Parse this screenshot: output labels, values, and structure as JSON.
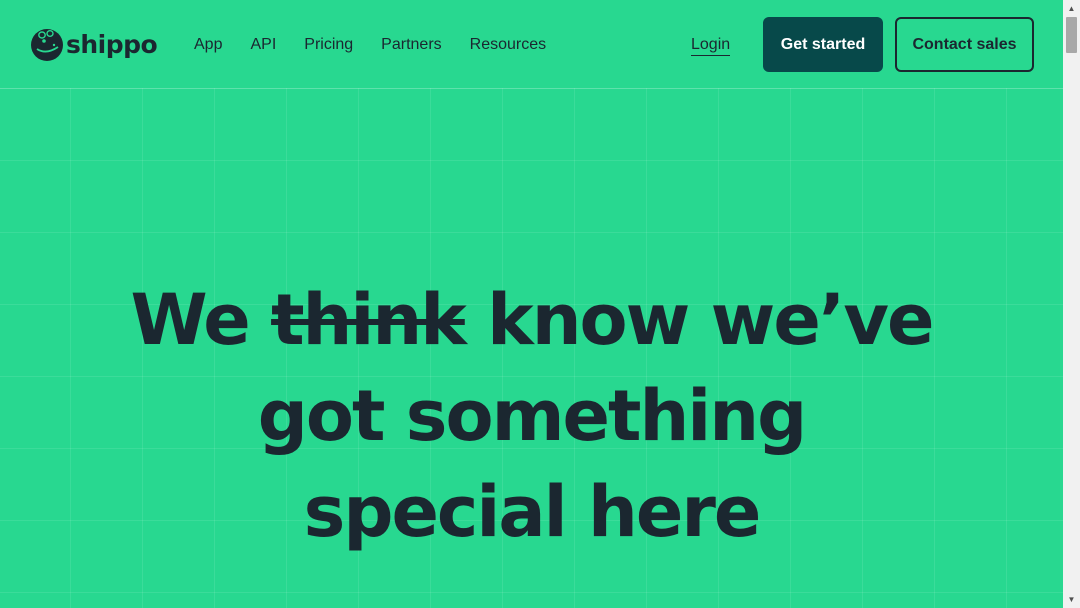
{
  "brand": {
    "name": "shippo",
    "logo_icon": "hippo-logo-icon"
  },
  "nav": {
    "items": [
      {
        "label": "App"
      },
      {
        "label": "API"
      },
      {
        "label": "Pricing"
      },
      {
        "label": "Partners"
      },
      {
        "label": "Resources"
      }
    ],
    "login_label": "Login",
    "get_started_label": "Get started",
    "contact_sales_label": "Contact sales"
  },
  "hero": {
    "line1_start": "We",
    "line1_struck": "think",
    "line1_end": "know we’ve",
    "line2": "got something",
    "line3": "special here"
  },
  "colors": {
    "background": "#28d890",
    "text": "#1b2730",
    "primary_button": "#07494a"
  }
}
